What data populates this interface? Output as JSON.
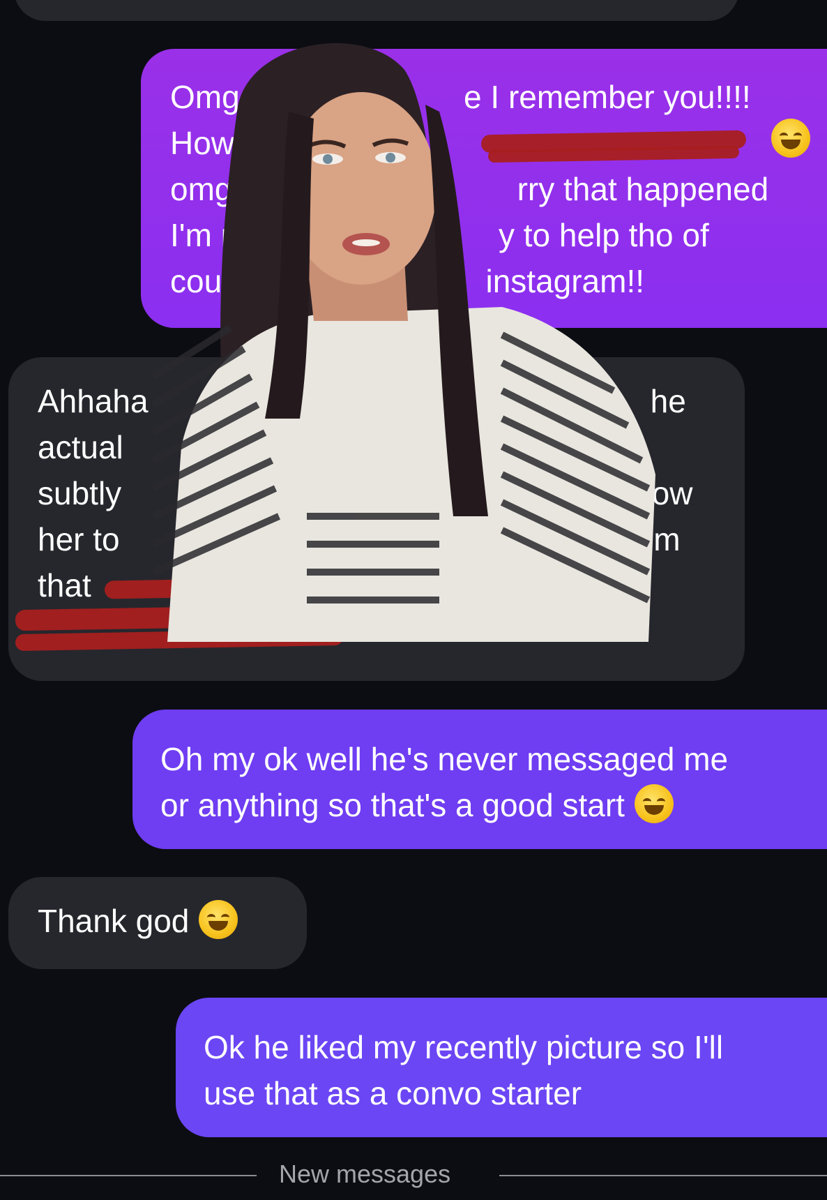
{
  "messages": [
    {
      "id": "bubble-1",
      "direction": "sent",
      "lines": [
        "Omg ye",
        "e I remember you!!!!",
        "How c",
        "omg r",
        "rry that happened",
        "I'm m",
        "y to help tho of",
        "cours",
        "instagram!!"
      ]
    },
    {
      "id": "bubble-2",
      "direction": "received",
      "lines": [
        "Ahhaha",
        "he",
        "actual",
        "subtly",
        "llow",
        "her to",
        "om",
        "that"
      ]
    },
    {
      "id": "bubble-3",
      "direction": "sent",
      "lines": [
        "Oh my ok well he's never messaged me",
        "or anything so that's a good start"
      ],
      "emoji": "rolling-on-floor-laughing"
    },
    {
      "id": "bubble-4",
      "direction": "received",
      "lines": [
        "Thank god"
      ],
      "emoji": "face-with-tears-of-joy"
    },
    {
      "id": "bubble-5",
      "direction": "sent",
      "lines": [
        "Ok he liked my recently picture so I'll",
        "use that as a convo starter"
      ]
    }
  ],
  "divider": {
    "label": "New messages"
  },
  "colors": {
    "background": "#0c0d12",
    "received_bubble": "#26272d",
    "sent_bubble_top": "#9a30e8",
    "sent_bubble_bottom": "#6b46f4",
    "redaction": "#a81f1f"
  }
}
